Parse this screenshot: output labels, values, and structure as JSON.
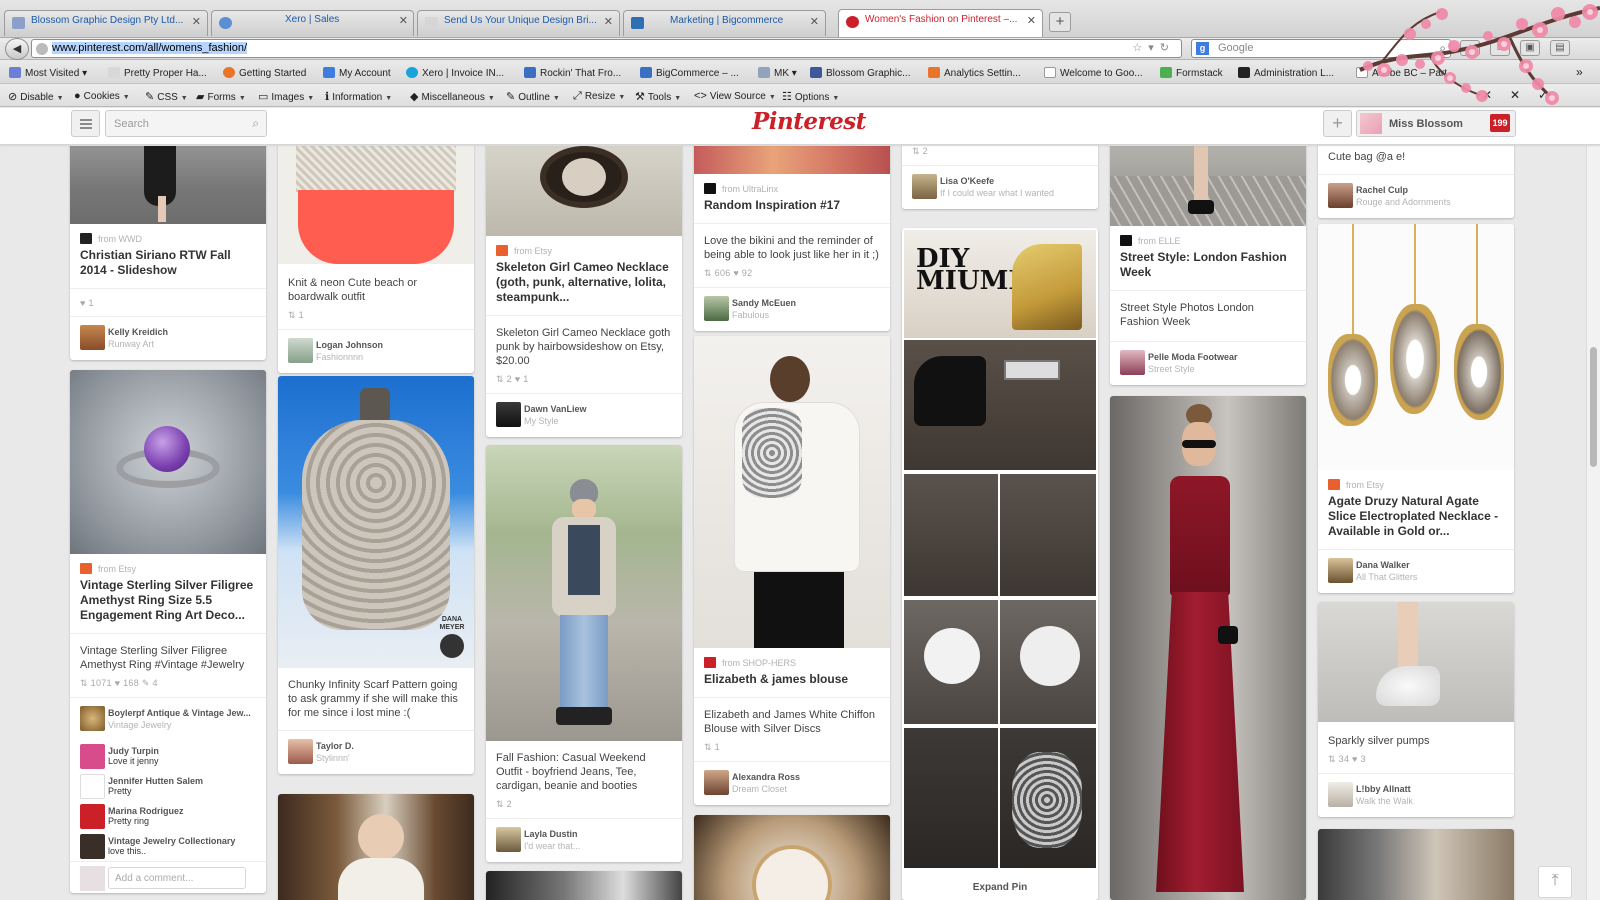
{
  "browser": {
    "tabs": [
      {
        "title": "Blossom Graphic Design Pty Ltd...",
        "active": false,
        "favicon_color": "#8aa0c8"
      },
      {
        "title": "",
        "active": false,
        "favicon_color": "#5b8fd4"
      },
      {
        "title": "Xero | Sales",
        "active": false,
        "favicon_color": "#e8e8e8"
      },
      {
        "title": "Send Us Your Unique Design Bri...",
        "active": false,
        "favicon_color": "#d6d6d6"
      },
      {
        "title": "Marketing | Bigcommerce",
        "active": false,
        "favicon_color": "#2f6fb3"
      },
      {
        "title": "Women's Fashion on Pinterest –...",
        "active": true,
        "favicon_color": "#cb2027"
      }
    ],
    "new_tab_label": "+",
    "url": "www.pinterest.com/all/womens_fashion/",
    "search_placeholder": "Google",
    "bookmarks": [
      {
        "label": "Most Visited",
        "icon": "star-icon",
        "dropdown": true
      },
      {
        "label": "Pretty Proper Ha...",
        "icon": "pin-icon"
      },
      {
        "label": "Getting Started",
        "icon": "firefox-icon"
      },
      {
        "label": "My Account",
        "icon": "google-icon"
      },
      {
        "label": "Xero | Invoice IN...",
        "icon": "xero-icon"
      },
      {
        "label": "Rockin' That Fro...",
        "icon": "pin-icon"
      },
      {
        "label": "BigCommerce – ...",
        "icon": "pin-icon"
      },
      {
        "label": "MK",
        "icon": "folder-icon",
        "dropdown": true
      },
      {
        "label": "Blossom Graphic...",
        "icon": "facebook-icon"
      },
      {
        "label": "Analytics Settin...",
        "icon": "analytics-icon"
      },
      {
        "label": "Welcome to Goo...",
        "icon": "page-icon"
      },
      {
        "label": "Formstack",
        "icon": "formstack-icon"
      },
      {
        "label": "Administration L...",
        "icon": "admin-icon"
      },
      {
        "label": "Adobe BC – Part...",
        "icon": "page-icon"
      }
    ],
    "devtools": [
      {
        "label": "Disable",
        "icon": "disable-icon"
      },
      {
        "label": "Cookies",
        "icon": "cookie-icon"
      },
      {
        "label": "CSS",
        "icon": "css-icon"
      },
      {
        "label": "Forms",
        "icon": "forms-icon"
      },
      {
        "label": "Images",
        "icon": "images-icon"
      },
      {
        "label": "Information",
        "icon": "information-icon"
      },
      {
        "label": "Miscellaneous",
        "icon": "misc-icon"
      },
      {
        "label": "Outline",
        "icon": "outline-icon"
      },
      {
        "label": "Resize",
        "icon": "resize-icon"
      },
      {
        "label": "Tools",
        "icon": "tools-icon"
      },
      {
        "label": "View Source",
        "icon": "source-icon"
      },
      {
        "label": "Options",
        "icon": "options-icon"
      }
    ]
  },
  "pinterest": {
    "logo": "Pinterest",
    "search_placeholder": "Search",
    "user_name": "Miss Blossom",
    "notifications": "199",
    "brand_color": "#cb2027"
  },
  "pins": [
    {
      "source": "from WWD",
      "title": "Christian Siriano RTW Fall 2014 - Slideshow",
      "stats": "♥ 1",
      "user": "Kelly Kreidich",
      "board": "Runway Art"
    },
    {
      "source": "from Etsy",
      "title": "Vintage Sterling Silver Filigree Amethyst Ring Size 5.5 Engagement Ring Art Deco...",
      "desc": "Vintage Sterling Silver Filigree Amethyst Ring #Vintage #Jewelry",
      "stats": "⇅ 1071   ♥ 168   ✎ 4",
      "user": "Boylerpf Antique & Vintage Jew...",
      "board": "Vintage Jewelry",
      "comments": [
        {
          "name": "Judy Turpin",
          "text": "Love it jenny"
        },
        {
          "name": "Jennifer Hutten Salem",
          "text": "Pretty"
        },
        {
          "name": "Marina Rodriguez",
          "text": "Pretty ring"
        },
        {
          "name": "Vintage Jewelry Collectionary",
          "text": "love this.."
        }
      ],
      "add_comment": "Add a comment..."
    },
    {
      "desc": "Knit & neon Cute beach or boardwalk outfit",
      "stats": "⇅ 1",
      "user": "Logan Johnson",
      "board": "Fashionnnn"
    },
    {
      "desc": "Chunky Infinity Scarf Pattern going to ask grammy if she will make this for me since i lost mine :(",
      "user": "Taylor D.",
      "board": "Stylinnn'",
      "image_text": "DANA MEYER"
    },
    {
      "source": "from Etsy",
      "title": "Skeleton Girl Cameo Necklace (goth, punk, alternative, lolita, steampunk...",
      "desc": "Skeleton Girl Cameo Necklace goth punk by hairbowsideshow on Etsy, $20.00",
      "stats": "⇅ 2   ♥ 1",
      "user": "Dawn VanLiew",
      "board": "My Style"
    },
    {
      "desc": "Fall Fashion: Casual Weekend Outfit - boyfriend Jeans, Tee, cardigan, beanie and booties",
      "stats": "⇅ 2",
      "user": "Layla Dustin",
      "board": "I'd wear that..."
    },
    {
      "source": "from UltraLinx",
      "title": "Random Inspiration #17",
      "desc": "Love the bikini and the reminder of being able to look just like her in it ;)",
      "stats": "⇅ 606   ♥ 92",
      "user": "Sandy McEuen",
      "board": "Fabulous"
    },
    {
      "source": "from SHOP-HERS",
      "title": "Elizabeth & james blouse",
      "desc": "Elizabeth and James White Chiffon Blouse with Silver Discs",
      "stats": "⇅ 1",
      "user": "Alexandra Ross",
      "board": "Dream Closet"
    },
    {
      "stats": "⇅ 2",
      "user": "Lisa O'Keefe",
      "board": "If I could wear what I wanted"
    },
    {
      "image_text": "DIY MIUMIU",
      "expand": "Expand Pin"
    },
    {
      "source": "from ELLE",
      "title": "Street Style: London Fashion Week",
      "desc": "Street Style Photos London Fashion Week",
      "user": "Pelle Moda Footwear",
      "board": "Street Style"
    },
    {
      "desc": "Cute bag @a e!",
      "user": "Rachel Culp",
      "board": "Rouge and Adornments"
    },
    {
      "source": "from Etsy",
      "title": "Agate Druzy Natural Agate Slice Electroplated Necklace - Available in Gold or...",
      "user": "Dana Walker",
      "board": "All That Glitters"
    },
    {
      "desc": "Sparkly silver pumps",
      "stats": "⇅ 34   ♥ 3",
      "user": "L!bby Allnatt",
      "board": "Walk the Walk"
    }
  ]
}
